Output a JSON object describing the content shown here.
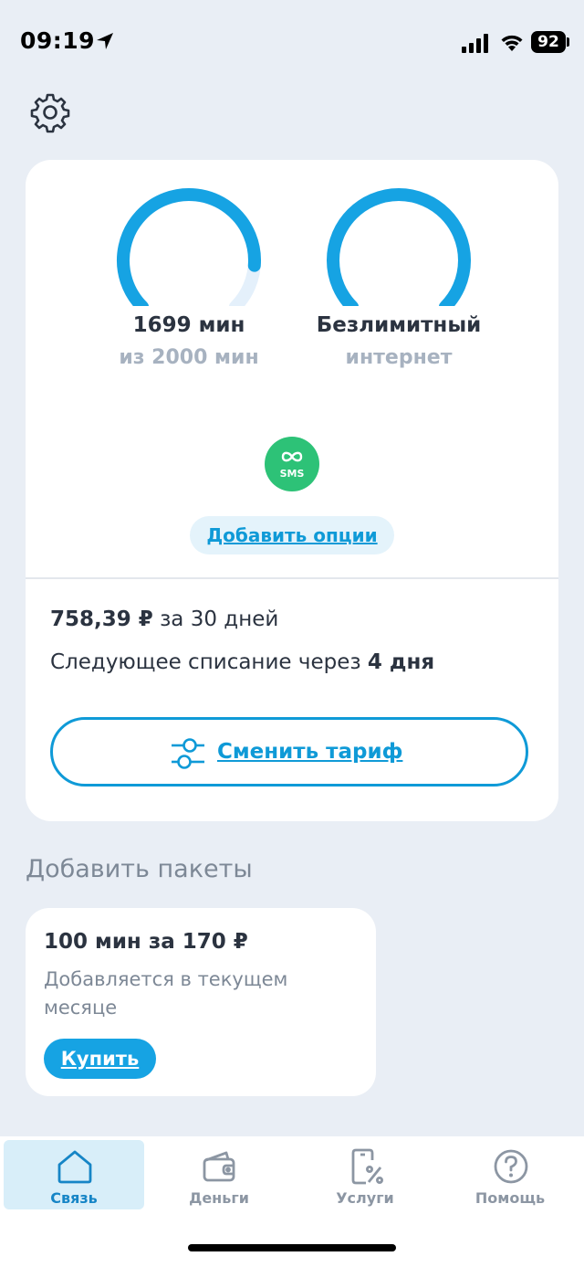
{
  "status_bar": {
    "time": "09:19",
    "battery": "92"
  },
  "gauges": [
    {
      "title": "1699 мин",
      "subtitle": "из 2000 мин",
      "fraction": 0.85
    },
    {
      "title": "Безлимитный",
      "subtitle": "интернет",
      "fraction": 1.0
    }
  ],
  "sms_badge": {
    "label": "SMS"
  },
  "add_options_label": "Добавить опции",
  "billing": {
    "amount": "758,39 ₽",
    "period": " за 30 дней",
    "next_prefix": "Следующее списание через ",
    "next_value": "4 дня"
  },
  "change_tariff_label": "Сменить тариф",
  "packages": {
    "section_title": "Добавить пакеты",
    "items": [
      {
        "title": "100 мин за 170 ₽",
        "description": "Добавляется в текущем месяце",
        "button": "Купить"
      }
    ]
  },
  "tabs": [
    {
      "label": "Связь",
      "icon": "home-icon",
      "active": true
    },
    {
      "label": "Деньги",
      "icon": "wallet-icon",
      "active": false
    },
    {
      "label": "Услуги",
      "icon": "phone-percent-icon",
      "active": false
    },
    {
      "label": "Помощь",
      "icon": "help-icon",
      "active": false
    }
  ],
  "colors": {
    "accent": "#0f9ad7",
    "gauge": "#16a3e3",
    "gauge_track": "#e4f0fb",
    "sms": "#2dc277",
    "muted": "#a7b2c0"
  }
}
